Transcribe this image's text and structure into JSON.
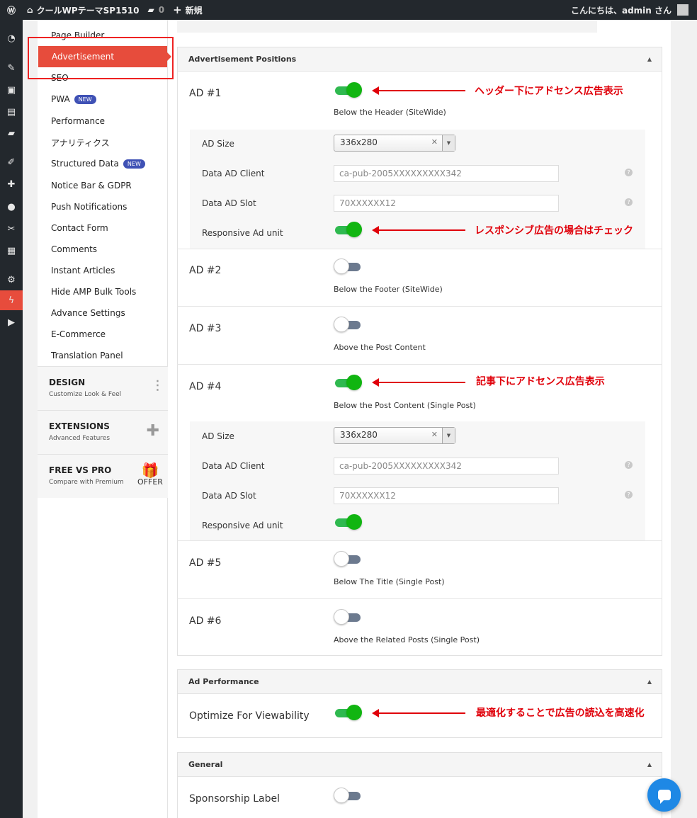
{
  "adminbar": {
    "site_name": "クールWPテーマSP1510",
    "comments_count": "0",
    "new_label": "新規",
    "greeting": "こんにちは、admin さん"
  },
  "nav": {
    "items": [
      {
        "label": "Page Builder"
      },
      {
        "label": "Advertisement"
      },
      {
        "label": "SEO"
      },
      {
        "label": "PWA",
        "badge": "NEW"
      },
      {
        "label": "Performance"
      },
      {
        "label": "アナリティクス"
      },
      {
        "label": "Structured Data",
        "badge": "NEW"
      },
      {
        "label": "Notice Bar & GDPR"
      },
      {
        "label": "Push Notifications"
      },
      {
        "label": "Contact Form"
      },
      {
        "label": "Comments"
      },
      {
        "label": "Instant Articles"
      },
      {
        "label": "Hide AMP Bulk Tools"
      },
      {
        "label": "Advance Settings"
      },
      {
        "label": "E-Commerce"
      },
      {
        "label": "Translation Panel"
      }
    ],
    "groups": [
      {
        "title": "DESIGN",
        "sub": "Customize Look & Feel"
      },
      {
        "title": "EXTENSIONS",
        "sub": "Advanced Features"
      },
      {
        "title": "FREE VS PRO",
        "sub": "Compare with Premium",
        "offer": "OFFER"
      }
    ]
  },
  "sections": {
    "ad_positions": "Advertisement Positions",
    "ad_performance": "Ad Performance",
    "general": "General"
  },
  "ads": [
    {
      "label": "AD #1",
      "desc": "Below the Header (SiteWide)",
      "on": true
    },
    {
      "label": "AD #2",
      "desc": "Below the Footer (SiteWide)",
      "on": false
    },
    {
      "label": "AD #3",
      "desc": "Above the Post Content",
      "on": false
    },
    {
      "label": "AD #4",
      "desc": "Below the Post Content (Single Post)",
      "on": true
    },
    {
      "label": "AD #5",
      "desc": "Below The Title (Single Post)",
      "on": false
    },
    {
      "label": "AD #6",
      "desc": "Above the Related Posts (Single Post)",
      "on": false
    }
  ],
  "ad_fields": {
    "size_label": "AD Size",
    "size_value": "336x280",
    "client_label": "Data AD Client",
    "client_value": "ca-pub-2005XXXXXXXXX342",
    "slot_label": "Data AD Slot",
    "slot_value": "70XXXXXX12",
    "responsive_label": "Responsive Ad unit"
  },
  "performance": {
    "label": "Optimize For Viewability",
    "on": true
  },
  "general": {
    "label": "Sponsorship Label",
    "on": false
  },
  "annotations": {
    "a1": "ヘッダー下にアドセンス広告表示",
    "a2": "レスポンシブ広告の場合はチェック",
    "a3": "記事下にアドセンス広告表示",
    "a4": "最適化することで広告の読込を高速化"
  },
  "colors": {
    "accent": "#e74c3c",
    "toggle_on": "#11b511",
    "annotation": "#e0000a"
  }
}
